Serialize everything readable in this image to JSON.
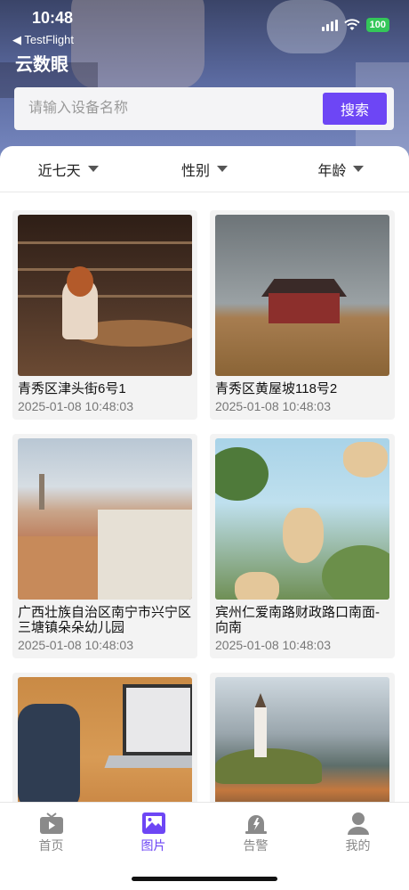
{
  "status_bar": {
    "time": "10:48",
    "back_label": "◀ TestFlight",
    "battery": "100"
  },
  "header": {
    "title": "云数眼"
  },
  "search": {
    "placeholder": "请输入设备名称",
    "button_label": "搜索"
  },
  "filters": [
    {
      "label": "近七天"
    },
    {
      "label": "性别"
    },
    {
      "label": "年龄"
    }
  ],
  "cards": [
    {
      "caption": "青秀区津头街6号1",
      "time": "2025-01-08 10:48:03"
    },
    {
      "caption": "青秀区黄屋坡118号2",
      "time": "2025-01-08 10:48:03"
    },
    {
      "caption": "广西壮族自治区南宁市兴宁区三塘镇朵朵幼儿园",
      "time": "2025-01-08 10:48:03"
    },
    {
      "caption": "宾州仁爱南路财政路口南面-向南",
      "time": "2025-01-08 10:48:03"
    },
    {
      "caption": "",
      "time": ""
    },
    {
      "caption": "",
      "time": ""
    }
  ],
  "tabbar": [
    {
      "label": "首页",
      "icon": "tv-icon"
    },
    {
      "label": "图片",
      "icon": "image-icon"
    },
    {
      "label": "告警",
      "icon": "alarm-bell-icon"
    },
    {
      "label": "我的",
      "icon": "user-icon"
    }
  ],
  "colors": {
    "accent": "#6d46f5",
    "battery": "#34c759"
  }
}
